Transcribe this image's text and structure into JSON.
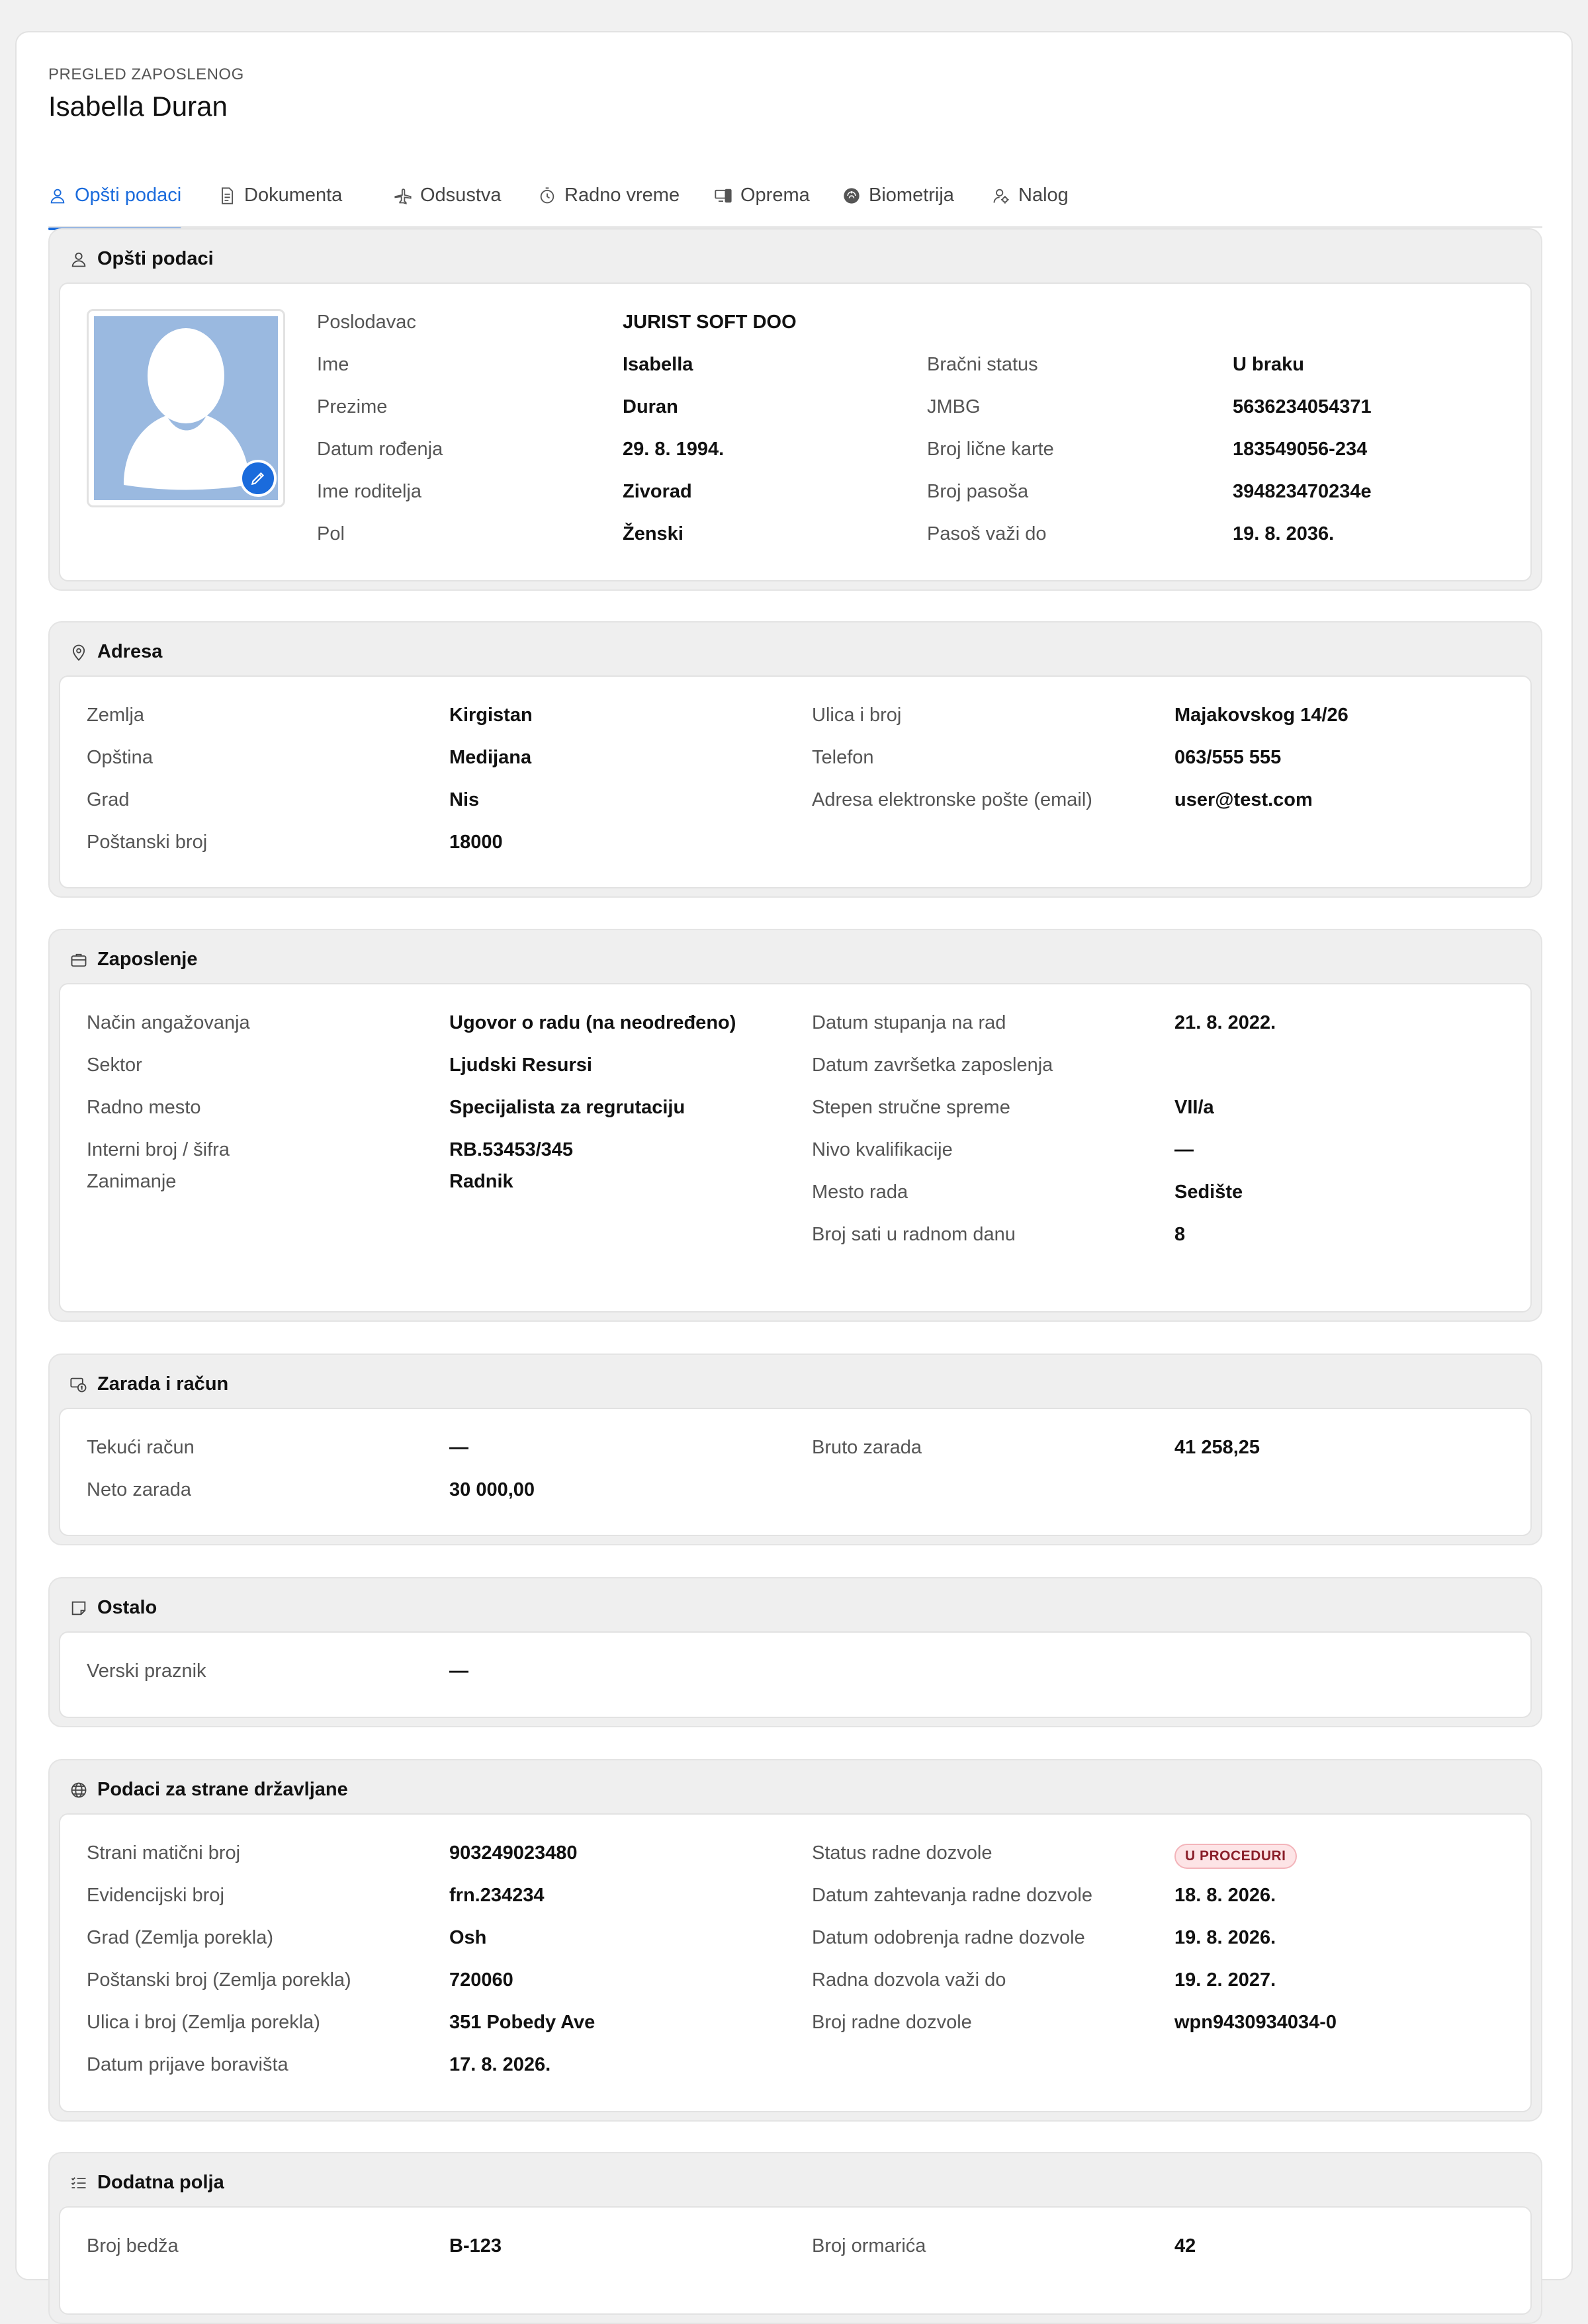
{
  "header": {
    "eyebrow": "PREGLED ZAPOSLENOG",
    "name": "Isabella Duran"
  },
  "tabs": [
    {
      "label": "Opšti podaci",
      "icon": "user-icon",
      "active": true
    },
    {
      "label": "Dokumenta",
      "icon": "document-icon"
    },
    {
      "label": "Odsustva",
      "icon": "airplane-icon"
    },
    {
      "label": "Radno vreme",
      "icon": "stopwatch-icon"
    },
    {
      "label": "Oprema",
      "icon": "devices-icon"
    },
    {
      "label": "Biometrija",
      "icon": "fingerprint-icon"
    },
    {
      "label": "Nalog",
      "icon": "user-gear-icon"
    }
  ],
  "colors": {
    "accent": "#1a6bdc",
    "badge_bg": "#fde4e6",
    "badge_text": "#8a1f2a",
    "avatar_bg": "#9ab9e0"
  },
  "general": {
    "title": "Opšti podaci",
    "left": [
      {
        "label": "Poslodavac",
        "value": "JURIST SOFT DOO"
      },
      {
        "label": "Ime",
        "value": "Isabella"
      },
      {
        "label": "Prezime",
        "value": "Duran"
      },
      {
        "label": "Datum rođenja",
        "value": "29. 8. 1994."
      },
      {
        "label": "Ime roditelja",
        "value": "Zivorad"
      },
      {
        "label": "Pol",
        "value": "Ženski"
      }
    ],
    "right": [
      {
        "label": "Bračni status",
        "value": "U braku"
      },
      {
        "label": "JMBG",
        "value": "5636234054371"
      },
      {
        "label": "Broj lične karte",
        "value": "183549056-234"
      },
      {
        "label": "Broj pasoša",
        "value": "394823470234e"
      },
      {
        "label": "Pasoš važi do",
        "value": "19. 8. 2036."
      }
    ]
  },
  "address": {
    "title": "Adresa",
    "left": [
      {
        "label": "Zemlja",
        "value": "Kirgistan"
      },
      {
        "label": "Opština",
        "value": "Medijana"
      },
      {
        "label": "Grad",
        "value": "Nis"
      },
      {
        "label": "Poštanski broj",
        "value": "18000"
      }
    ],
    "right": [
      {
        "label": "Ulica i broj",
        "value": "Majakovskog 14/26"
      },
      {
        "label": "Telefon",
        "value": "063/555 555"
      },
      {
        "label": "Adresa elektronske pošte (email)",
        "value": "user@test.com"
      }
    ]
  },
  "employment": {
    "title": "Zaposlenje",
    "left": [
      {
        "label": "Način angažovanja",
        "value": "Ugovor o radu (na neodređeno)"
      },
      {
        "label": "Sektor",
        "value": "Ljudski Resursi"
      },
      {
        "label": "Radno mesto",
        "value": "Specijalista za regrutaciju"
      },
      {
        "label": "Interni broj / šifra",
        "value": "RB.53453/345"
      },
      {
        "label": "Zanimanje",
        "value": "Radnik"
      }
    ],
    "right": [
      {
        "label": "Datum stupanja na rad",
        "value": "21. 8. 2022."
      },
      {
        "label": "Datum završetka zaposlenja",
        "value": ""
      },
      {
        "label": "Stepen stručne spreme",
        "value": "VII/a"
      },
      {
        "label": "Nivo kvalifikacije",
        "value": "—"
      },
      {
        "label": "Mesto rada",
        "value": "Sedište"
      },
      {
        "label": "Broj sati u radnom danu",
        "value": "8"
      }
    ]
  },
  "salary": {
    "title": "Zarada i račun",
    "left": [
      {
        "label": "Tekući račun",
        "value": "—"
      },
      {
        "label": "Neto zarada",
        "value": "30 000,00"
      }
    ],
    "right": [
      {
        "label": "Bruto zarada",
        "value": "41 258,25"
      }
    ]
  },
  "other": {
    "title": "Ostalo",
    "left": [
      {
        "label": "Verski praznik",
        "value": "—"
      }
    ]
  },
  "foreign": {
    "title": "Podaci za strane državljane",
    "left": [
      {
        "label": "Strani matični broj",
        "value": "903249023480"
      },
      {
        "label": "Evidencijski broj",
        "value": "frn.234234"
      },
      {
        "label": "Grad (Zemlja porekla)",
        "value": "Osh"
      },
      {
        "label": "Poštanski broj (Zemlja porekla)",
        "value": "720060"
      },
      {
        "label": "Ulica i broj (Zemlja porekla)",
        "value": "351 Pobedy Ave"
      },
      {
        "label": "Datum prijave boravišta",
        "value": "17. 8. 2026."
      }
    ],
    "right": [
      {
        "label": "Status radne dozvole",
        "value": "U PROCEDURI"
      },
      {
        "label": "Datum zahtevanja radne dozvole",
        "value": "18. 8. 2026."
      },
      {
        "label": "Datum odobrenja radne dozvole",
        "value": "19. 8. 2026."
      },
      {
        "label": "Radna dozvola važi do",
        "value": "19. 2. 2027."
      },
      {
        "label": "Broj radne dozvole",
        "value": "wpn9430934034-0"
      }
    ]
  },
  "extra": {
    "title": "Dodatna polja",
    "left": [
      {
        "label": "Broj bedža",
        "value": "B-123"
      }
    ],
    "right": [
      {
        "label": "Broj ormarića",
        "value": "42"
      }
    ]
  }
}
